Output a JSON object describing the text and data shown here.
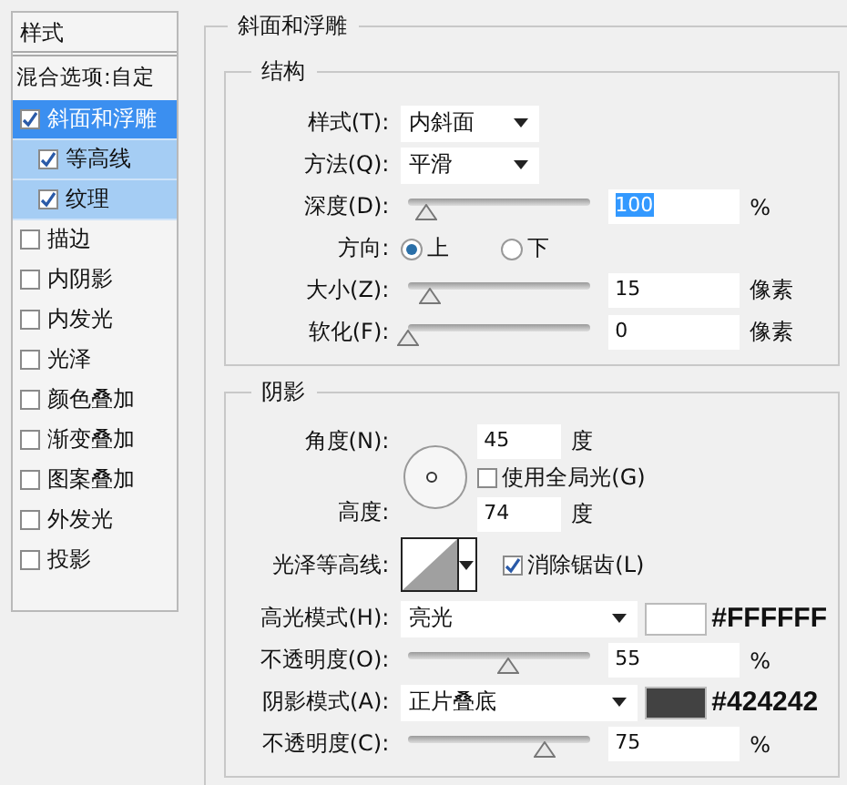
{
  "sidebar": {
    "title": "样式",
    "blend_options": "混合选项:自定",
    "items": [
      {
        "label": "斜面和浮雕",
        "checked": true,
        "selected": true,
        "children": [
          {
            "label": "等高线",
            "checked": true,
            "selected": false
          },
          {
            "label": "纹理",
            "checked": true,
            "selected": false
          }
        ]
      },
      {
        "label": "描边",
        "checked": false,
        "selected": false
      },
      {
        "label": "内阴影",
        "checked": false,
        "selected": false
      },
      {
        "label": "内发光",
        "checked": false,
        "selected": false
      },
      {
        "label": "光泽",
        "checked": false,
        "selected": false
      },
      {
        "label": "颜色叠加",
        "checked": false,
        "selected": false
      },
      {
        "label": "渐变叠加",
        "checked": false,
        "selected": false
      },
      {
        "label": "图案叠加",
        "checked": false,
        "selected": false
      },
      {
        "label": "外发光",
        "checked": false,
        "selected": false
      },
      {
        "label": "投影",
        "checked": false,
        "selected": false
      }
    ]
  },
  "panel": {
    "title": "斜面和浮雕",
    "structure": {
      "title": "结构",
      "style": {
        "label": "样式(T):",
        "value": "内斜面"
      },
      "technique": {
        "label": "方法(Q):",
        "value": "平滑"
      },
      "depth": {
        "label": "深度(D):",
        "value": "100",
        "unit": "%",
        "level": 0.1,
        "value_selected": true
      },
      "direction": {
        "label": "方向:",
        "options": [
          {
            "label": "上",
            "selected": true
          },
          {
            "label": "下",
            "selected": false
          }
        ]
      },
      "size": {
        "label": "大小(Z):",
        "value": "15",
        "unit": "像素",
        "level": 0.12
      },
      "soften": {
        "label": "软化(F):",
        "value": "0",
        "unit": "像素",
        "level": 0
      }
    },
    "shading": {
      "title": "阴影",
      "angle": {
        "label": "角度(N):",
        "value": "45",
        "unit": "度"
      },
      "global_light": {
        "label": "使用全局光(G)",
        "checked": false
      },
      "altitude": {
        "label": "高度:",
        "value": "74",
        "unit": "度"
      },
      "gloss_contour": {
        "label": "光泽等高线:"
      },
      "anti_aliased": {
        "label": "消除锯齿(L)",
        "checked": true
      },
      "highlight_mode": {
        "label": "高光模式(H):",
        "value": "亮光",
        "color": "#ffffff",
        "color_label": "#FFFFFF"
      },
      "highlight_opacity": {
        "label": "不透明度(O):",
        "value": "55",
        "unit": "%",
        "level": 0.55
      },
      "shadow_mode": {
        "label": "阴影模式(A):",
        "value": "正片叠底",
        "color": "#424242",
        "color_label": "#424242"
      },
      "shadow_opacity": {
        "label": "不透明度(C):",
        "value": "75",
        "unit": "%",
        "level": 0.75
      }
    }
  }
}
